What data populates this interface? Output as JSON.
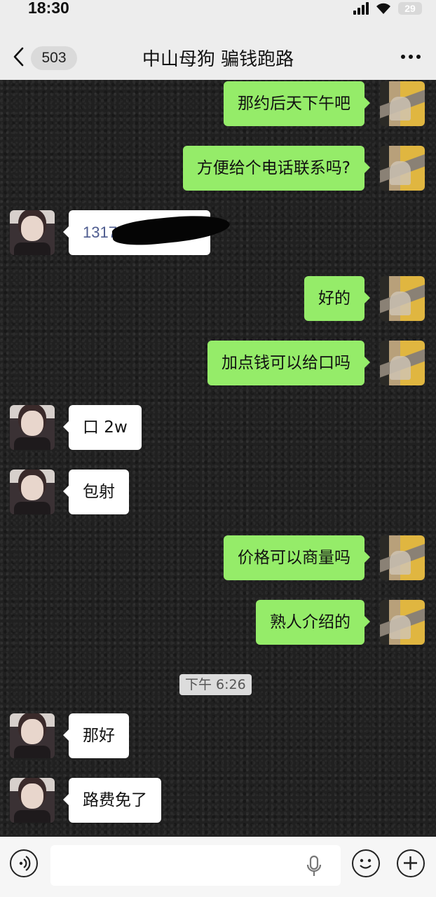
{
  "status_bar": {
    "time": "18:30",
    "battery": "29"
  },
  "header": {
    "unread_count": "503",
    "title": "中山母狗 骗钱跑路"
  },
  "messages": [
    {
      "side": "me",
      "text": "那约后天下午吧"
    },
    {
      "side": "me",
      "text": "方便给个电话联系吗?"
    },
    {
      "side": "them",
      "text": "1317",
      "redacted": true
    },
    {
      "side": "me",
      "text": "好的"
    },
    {
      "side": "me",
      "text": "加点钱可以给口吗"
    },
    {
      "side": "them",
      "text": "口 2w"
    },
    {
      "side": "them",
      "text": "包射"
    },
    {
      "side": "me",
      "text": "价格可以商量吗"
    },
    {
      "side": "me",
      "text": "熟人介绍的"
    },
    {
      "side": "them",
      "text": "那好"
    },
    {
      "side": "them",
      "text": "路费免了"
    }
  ],
  "timestamp": "下午 6:26",
  "input_bar": {
    "placeholder": ""
  },
  "icons": [
    "back-icon",
    "more-icon",
    "voice-icon",
    "mic-icon",
    "emoji-icon",
    "plus-icon"
  ],
  "colors": {
    "my_bubble": "#95ec69",
    "their_bubble": "#ffffff",
    "chat_background": "#202020"
  }
}
